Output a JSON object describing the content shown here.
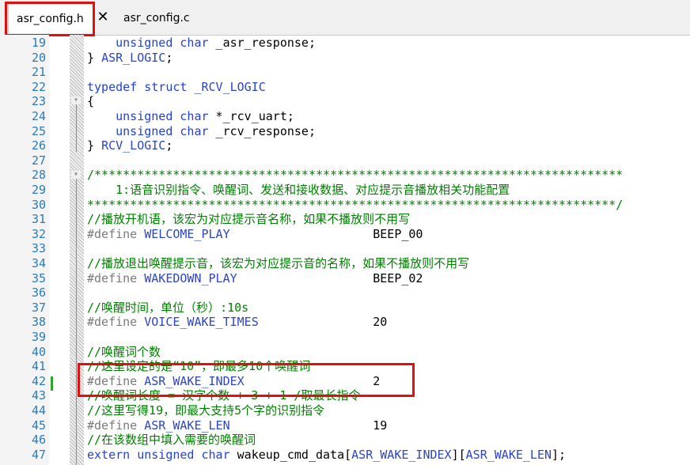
{
  "tabs": [
    {
      "label": "asr_config.h",
      "active": true
    },
    {
      "label": "asr_config.c",
      "active": false
    }
  ],
  "close_glyph": "✕",
  "colors": {
    "keyword": "#2040e0",
    "comment": "#008000",
    "preprocessor": "#7a7a7a",
    "line_number": "#2b7bb9",
    "highlight": "#e01010"
  },
  "editor": {
    "lines": [
      {
        "n": "19",
        "segs": [
          {
            "t": "    "
          },
          {
            "t": "unsigned",
            "c": "kw"
          },
          {
            "t": " "
          },
          {
            "t": "char",
            "c": "kw"
          },
          {
            "t": " _asr_response;"
          }
        ]
      },
      {
        "n": "20",
        "segs": [
          {
            "t": "} "
          },
          {
            "t": "ASR_LOGIC",
            "c": "mac"
          },
          {
            "t": ";"
          }
        ]
      },
      {
        "n": "21",
        "segs": []
      },
      {
        "n": "22",
        "segs": [
          {
            "t": "typedef",
            "c": "kw"
          },
          {
            "t": " "
          },
          {
            "t": "struct",
            "c": "kw"
          },
          {
            "t": " _RCV_LOGIC",
            "c": "mac"
          }
        ]
      },
      {
        "n": "23",
        "segs": [
          {
            "t": "{"
          }
        ]
      },
      {
        "n": "24",
        "segs": [
          {
            "t": "    "
          },
          {
            "t": "unsigned",
            "c": "kw"
          },
          {
            "t": " "
          },
          {
            "t": "char",
            "c": "kw"
          },
          {
            "t": " *_rcv_uart;"
          }
        ]
      },
      {
        "n": "25",
        "segs": [
          {
            "t": "    "
          },
          {
            "t": "unsigned",
            "c": "kw"
          },
          {
            "t": " "
          },
          {
            "t": "char",
            "c": "kw"
          },
          {
            "t": " _rcv_response;"
          }
        ]
      },
      {
        "n": "26",
        "segs": [
          {
            "t": "} "
          },
          {
            "t": "RCV_LOGIC",
            "c": "mac"
          },
          {
            "t": ";"
          }
        ]
      },
      {
        "n": "27",
        "segs": []
      },
      {
        "n": "28",
        "segs": [
          {
            "t": "/**************************************************************************",
            "c": "cm"
          }
        ]
      },
      {
        "n": "29",
        "segs": [
          {
            "t": "    1:语音识别指令、唤醒词、发送和接收数据、对应提示音播放相关功能配置",
            "c": "cm"
          }
        ]
      },
      {
        "n": "30",
        "segs": [
          {
            "t": "**************************************************************************/",
            "c": "cm"
          }
        ]
      },
      {
        "n": "31",
        "segs": [
          {
            "t": "//播放开机语，该宏为对应提示音名称，如果不播放则不用写",
            "c": "cm"
          }
        ]
      },
      {
        "n": "32",
        "segs": [
          {
            "t": "#define ",
            "c": "pp"
          },
          {
            "t": "WELCOME_PLAY",
            "c": "mac"
          },
          {
            "t": "                    BEEP_00"
          }
        ]
      },
      {
        "n": "33",
        "segs": []
      },
      {
        "n": "34",
        "segs": [
          {
            "t": "//播放退出唤醒提示音，该宏为对应提示音的名称，如果不播放则不用写",
            "c": "cm"
          }
        ]
      },
      {
        "n": "35",
        "segs": [
          {
            "t": "#define ",
            "c": "pp"
          },
          {
            "t": "WAKEDOWN_PLAY",
            "c": "mac"
          },
          {
            "t": "                   BEEP_02"
          }
        ]
      },
      {
        "n": "36",
        "segs": []
      },
      {
        "n": "37",
        "segs": [
          {
            "t": "//唤醒时间，单位（秒）:10s",
            "c": "cm"
          }
        ]
      },
      {
        "n": "38",
        "segs": [
          {
            "t": "#define ",
            "c": "pp"
          },
          {
            "t": "VOICE_WAKE_TIMES",
            "c": "mac"
          },
          {
            "t": "                20"
          }
        ]
      },
      {
        "n": "39",
        "segs": []
      },
      {
        "n": "40",
        "segs": [
          {
            "t": "//唤醒词个数",
            "c": "cm"
          }
        ]
      },
      {
        "n": "41",
        "segs": [
          {
            "t": "//这里设定的是“10”，即最多10个唤醒词",
            "c": "cm"
          }
        ]
      },
      {
        "n": "42",
        "segs": [
          {
            "t": "#define ",
            "c": "pp"
          },
          {
            "t": "ASR_WAKE_INDEX",
            "c": "mac"
          },
          {
            "t": "                  2"
          }
        ]
      },
      {
        "n": "43",
        "segs": [
          {
            "t": "//唤醒词长度 = 汉字个数 + 3 + 1 /取最长指令",
            "c": "cm"
          }
        ]
      },
      {
        "n": "44",
        "segs": [
          {
            "t": "//这里写得19，即最大支持5个字的识别指令",
            "c": "cm"
          }
        ]
      },
      {
        "n": "45",
        "segs": [
          {
            "t": "#define ",
            "c": "pp"
          },
          {
            "t": "ASR_WAKE_LEN",
            "c": "mac"
          },
          {
            "t": "                    19"
          }
        ]
      },
      {
        "n": "46",
        "segs": [
          {
            "t": "//在该数组中填入需要的唤醒词",
            "c": "cm"
          }
        ]
      },
      {
        "n": "47",
        "segs": [
          {
            "t": "extern",
            "c": "kw"
          },
          {
            "t": " "
          },
          {
            "t": "unsigned",
            "c": "kw"
          },
          {
            "t": " "
          },
          {
            "t": "char",
            "c": "kw"
          },
          {
            "t": " wakeup_cmd_data["
          },
          {
            "t": "ASR_WAKE_INDEX",
            "c": "mac"
          },
          {
            "t": "]["
          },
          {
            "t": "ASR_WAKE_LEN",
            "c": "mac"
          },
          {
            "t": "];"
          }
        ]
      }
    ]
  }
}
